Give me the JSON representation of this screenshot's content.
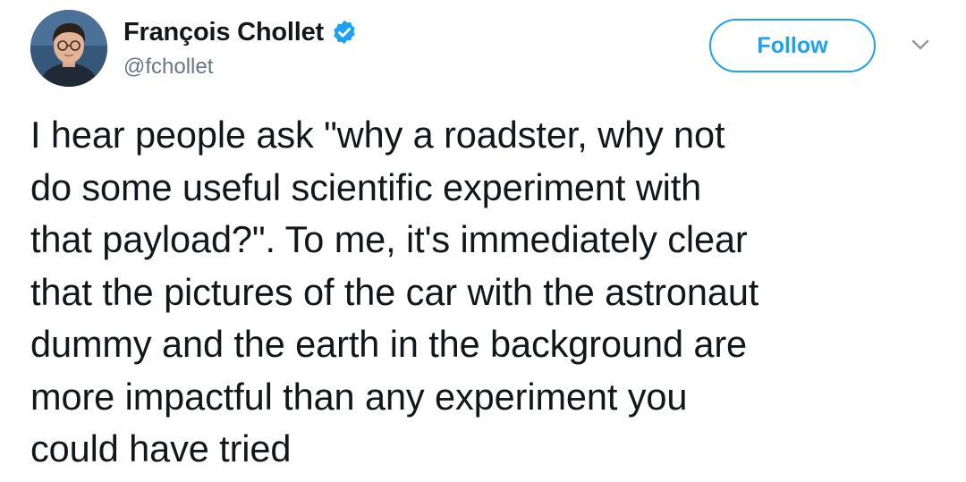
{
  "author": {
    "display_name": "François Chollet",
    "handle": "@fchollet",
    "verified": true
  },
  "actions": {
    "follow_label": "Follow"
  },
  "tweet": {
    "text": "I hear people ask \"why a roadster, why not\ndo some useful scientific experiment with\nthat payload?\". To me, it's immediately clear\nthat the pictures of the car with the astronaut\ndummy and the earth in the background are\nmore impactful than any experiment you\ncould have tried"
  },
  "icons": {
    "verified": "verified-badge-icon",
    "more": "chevron-down-icon"
  },
  "colors": {
    "accent": "#1da1f2",
    "text": "#14171a",
    "muted": "#657786"
  }
}
